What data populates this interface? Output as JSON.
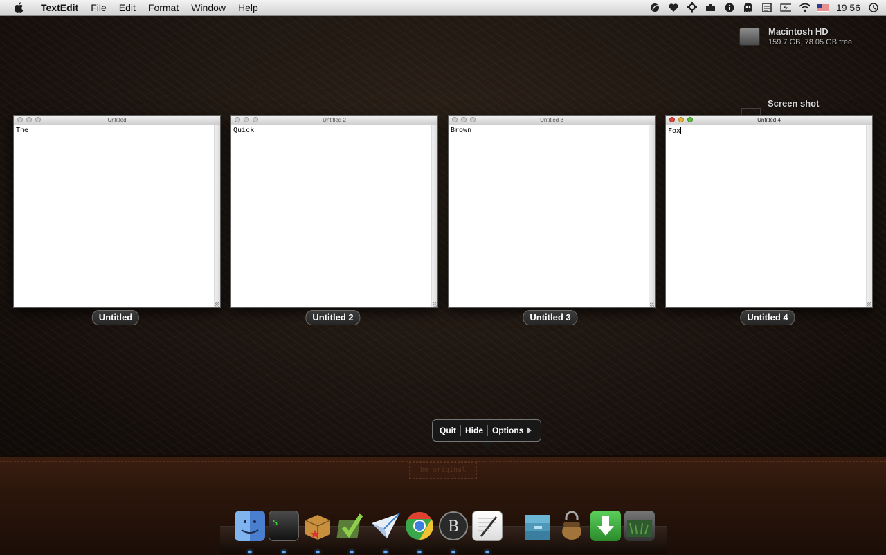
{
  "menubar": {
    "app_name": "TextEdit",
    "items": [
      "File",
      "Edit",
      "Format",
      "Window",
      "Help"
    ],
    "clock": "19 56"
  },
  "desktop": {
    "disk": {
      "name": "Macintosh HD",
      "free": "159.7 GB, 78.05 GB free"
    },
    "screenshot": {
      "name": "Screen shot"
    }
  },
  "windows": [
    {
      "title": "Untitled",
      "text": "The",
      "label": "Untitled",
      "active": false
    },
    {
      "title": "Untitled 2",
      "text": "Quick",
      "label": "Untitled 2",
      "active": false
    },
    {
      "title": "Untitled 3",
      "text": "Brown",
      "label": "Untitled 3",
      "active": false
    },
    {
      "title": "Untitled 4",
      "text": "Fox",
      "label": "Untitled 4",
      "active": true
    }
  ],
  "popup": {
    "quit": "Quit",
    "hide": "Hide",
    "options": "Options"
  },
  "shelf_tag": "be original",
  "dock": [
    {
      "name": "finder-icon",
      "color": "#5b8fd6"
    },
    {
      "name": "terminal-icon",
      "color": "#2a2a2a"
    },
    {
      "name": "package-icon",
      "color": "#c8903c"
    },
    {
      "name": "checkmark-app-icon",
      "color": "#6a9a3c"
    },
    {
      "name": "paper-plane-icon",
      "color": "#3b7fc4"
    },
    {
      "name": "chrome-icon",
      "color": "#d9402f"
    },
    {
      "name": "b-app-icon",
      "color": "#3a3a3a"
    },
    {
      "name": "textedit-icon",
      "color": "#f2f2f2"
    },
    {
      "name": "archive-icon",
      "color": "#5ea0c0"
    },
    {
      "name": "acorn-lock-icon",
      "color": "#a0743a"
    },
    {
      "name": "download-icon",
      "color": "#3aa83a"
    },
    {
      "name": "drive-icon",
      "color": "#2e5a2e"
    }
  ]
}
